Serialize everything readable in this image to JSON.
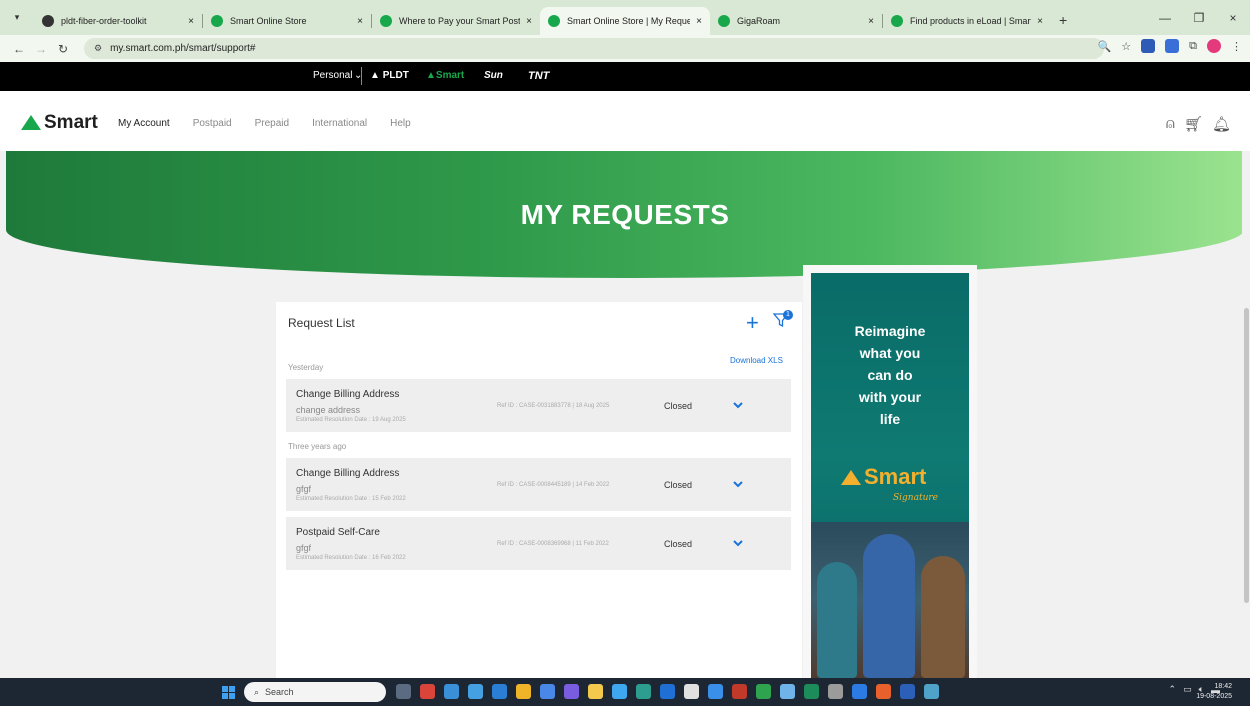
{
  "browser": {
    "tabs": [
      {
        "title": "pldt-fiber-order-toolkit",
        "icon_color": "#333333",
        "active": false
      },
      {
        "title": "Smart Online Store",
        "icon_color": "#18a84b",
        "active": false
      },
      {
        "title": "Where to Pay your Smart Postp",
        "icon_color": "#18a84b",
        "active": false
      },
      {
        "title": "Smart Online Store | My Reque",
        "icon_color": "#18a84b",
        "active": true
      },
      {
        "title": "GigaRoam",
        "icon_color": "#18a84b",
        "active": false
      },
      {
        "title": "Find products in eLoad | Smart",
        "icon_color": "#18a84b",
        "active": false
      }
    ],
    "url": "my.smart.com.ph/smart/support#",
    "close_glyph": "×",
    "new_tab_glyph": "+"
  },
  "brandstrip": {
    "personal_label": "Personal",
    "brands": [
      "PLDT",
      "Smart",
      "Sun",
      "TNT"
    ],
    "brand_colors": {
      "PLDT": "#ffffff",
      "Smart": "#18a84b",
      "Sun": "#ffffff",
      "TNT": "#ffffff"
    }
  },
  "header": {
    "logo_text": "Smart",
    "nav": [
      "My Account",
      "Postpaid",
      "Prepaid",
      "International",
      "Help"
    ],
    "active_nav": "My Account"
  },
  "hero": {
    "title": "MY REQUESTS"
  },
  "requests": {
    "title": "Request List",
    "filter_badge": "1",
    "download_label": "Download XLS",
    "groups": [
      {
        "label": "Yesterday",
        "items": [
          {
            "title": "Change Billing Address",
            "description": "change address",
            "estimate": "Estimated Resolution Date : 19 Aug 2025",
            "ref": "Ref ID : CASE-0031883778 | 18 Aug 2025",
            "status": "Closed"
          }
        ]
      },
      {
        "label": "Three years ago",
        "items": [
          {
            "title": "Change Billing Address",
            "description": "gfgf",
            "estimate": "Estimated Resolution Date : 15 Feb 2022",
            "ref": "Ref ID : CASE-0008445189 | 14 Feb 2022",
            "status": "Closed"
          },
          {
            "title": "Postpaid Self-Care",
            "description": "gfgf",
            "estimate": "Estimated Resolution Date : 16 Feb 2022",
            "ref": "Ref ID : CASE-0008369968 | 11 Feb 2022",
            "status": "Closed"
          }
        ]
      }
    ]
  },
  "ad": {
    "lines": [
      "Reimagine",
      "what you",
      "can do",
      "with your",
      "life"
    ],
    "logo_text": "Smart",
    "signature": "Signature"
  },
  "taskbar": {
    "search_placeholder": "Search",
    "time": "18:42",
    "date": "19-08-2025"
  },
  "colors": {
    "accent_blue": "#1a73d9",
    "smart_green": "#18a84b",
    "ad_teal": "#0e7a72",
    "ad_gold": "#f2b02e"
  }
}
